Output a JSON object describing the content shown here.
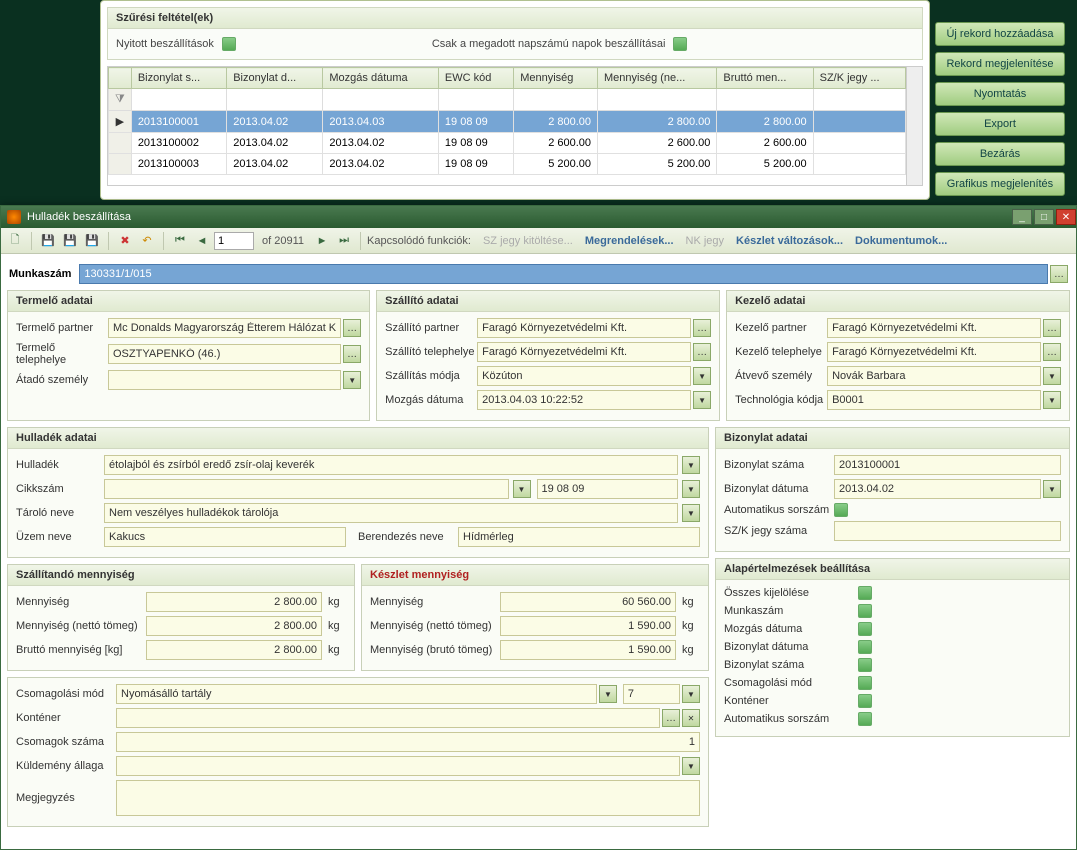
{
  "filter": {
    "title": "Szűrési feltétel(ek)",
    "open_delivery": "Nyitott beszállítások",
    "only_days": "Csak a megadott napszámú napok beszállításai"
  },
  "side_buttons": {
    "new": "Új rekord hozzáadása",
    "show": "Rekord megjelenítése",
    "print": "Nyomtatás",
    "export": "Export",
    "close": "Bezárás",
    "graph": "Grafikus megjelenítés"
  },
  "grid": {
    "headers": [
      "Bizonylat s...",
      "Bizonylat d...",
      "Mozgás dátuma",
      "EWC kód",
      "Mennyiség",
      "Mennyiség (ne...",
      "Bruttó men...",
      "SZ/K jegy ..."
    ],
    "rows": [
      {
        "sel": true,
        "cells": [
          "2013100001",
          "2013.04.02",
          "2013.04.03",
          "19 08 09",
          "2 800.00",
          "2 800.00",
          "2 800.00",
          ""
        ]
      },
      {
        "sel": false,
        "cells": [
          "2013100002",
          "2013.04.02",
          "2013.04.02",
          "19 08 09",
          "2 600.00",
          "2 600.00",
          "2 600.00",
          ""
        ]
      },
      {
        "sel": false,
        "cells": [
          "2013100003",
          "2013.04.02",
          "2013.04.02",
          "19 08 09",
          "5 200.00",
          "5 200.00",
          "5 200.00",
          ""
        ]
      }
    ]
  },
  "window": {
    "title": "Hulladék beszállítása",
    "page_current": "1",
    "page_total": "of 20911",
    "related_label": "Kapcsolódó funkciók:",
    "links": {
      "szjegy": "SZ jegy kitöltése...",
      "megrendelesek": "Megrendelések...",
      "nkjegy": "NK jegy",
      "keszlet": "Készlet változások...",
      "dokumentumok": "Dokumentumok..."
    }
  },
  "munkaszam": {
    "label": "Munkaszám",
    "value": "130331/1/015"
  },
  "termelo": {
    "title": "Termelő adatai",
    "partner_l": "Termelő partner",
    "partner": "Mc Donalds Magyarország Étterem Hálózat K",
    "telephely_l": "Termelő telephelye",
    "telephely": "OSZTYAPENKÓ (46.)",
    "atado_l": "Átadó személy",
    "atado": ""
  },
  "szallito": {
    "title": "Szállító adatai",
    "partner_l": "Szállító partner",
    "partner": "Faragó Környezetvédelmi Kft.",
    "telephely_l": "Szállító telephelye",
    "telephely": "Faragó  Környezetvédelmi Kft.",
    "modja_l": "Szállítás módja",
    "modja": "Közúton",
    "mozgas_l": "Mozgás dátuma",
    "mozgas": "2013.04.03 10:22:52"
  },
  "kezelo": {
    "title": "Kezelő adatai",
    "partner_l": "Kezelő partner",
    "partner": "Faragó Környezetvédelmi Kft.",
    "telephely_l": "Kezelő telephelye",
    "telephely": "Faragó  Környezetvédelmi Kft.",
    "atvevo_l": "Átvevő személy",
    "atvevo": "Novák Barbara",
    "tech_l": "Technológia kódja",
    "tech": "B0001"
  },
  "hulladek": {
    "title": "Hulladék adatai",
    "hulladek_l": "Hulladék",
    "hulladek": "étolajból és zsírból eredő zsír-olaj keverék",
    "cikkszam_l": "Cikkszám",
    "cikkszam": "",
    "ewc": "19 08 09",
    "tarolo_l": "Tároló neve",
    "tarolo": "Nem veszélyes hulladékok tárolója",
    "uzem_l": "Üzem neve",
    "uzem": "Kakucs",
    "berendezes_l": "Berendezés neve",
    "berendezes": "Hídmérleg"
  },
  "szall_qty": {
    "title": "Szállítandó mennyiség",
    "mennyiseg_l": "Mennyiség",
    "mennyiseg": "2 800.00",
    "netto_l": "Mennyiség (nettó tömeg)",
    "netto": "2 800.00",
    "brutto_l": "Bruttó mennyiség [kg]",
    "brutto": "2 800.00",
    "unit": "kg"
  },
  "keszlet_qty": {
    "title": "Készlet mennyiség",
    "mennyiseg_l": "Mennyiség",
    "mennyiseg": "60 560.00",
    "netto_l": "Mennyiség (nettó tömeg)",
    "netto": "1 590.00",
    "brutto_l": "Mennyiség (brutó tömeg)",
    "brutto": "1 590.00",
    "unit": "kg"
  },
  "extras": {
    "csom_mod_l": "Csomagolási mód",
    "csom_mod": "Nyomásálló tartály",
    "csom_count": "7",
    "kontener_l": "Konténer",
    "kontener": "",
    "csomagok_l": "Csomagok száma",
    "csomagok": "1",
    "kuldemeny_l": "Küldemény állaga",
    "kuldemeny": "",
    "megjegyzes_l": "Megjegyzés",
    "megjegyzes": ""
  },
  "bizonylat": {
    "title": "Bizonylat adatai",
    "szama_l": "Bizonylat száma",
    "szama": "2013100001",
    "datuma_l": "Bizonylat dátuma",
    "datuma": "2013.04.02",
    "auto_l": "Automatikus sorszám",
    "szk_l": "SZ/K jegy száma",
    "szk": ""
  },
  "defaults": {
    "title": "Alapértelmezések beállítása",
    "items": [
      "Összes kijelölése",
      "Munkaszám",
      "Mozgás dátuma",
      "Bizonylat dátuma",
      "Bizonylat száma",
      "Csomagolási mód",
      "Konténer",
      "Automatikus sorszám"
    ]
  }
}
